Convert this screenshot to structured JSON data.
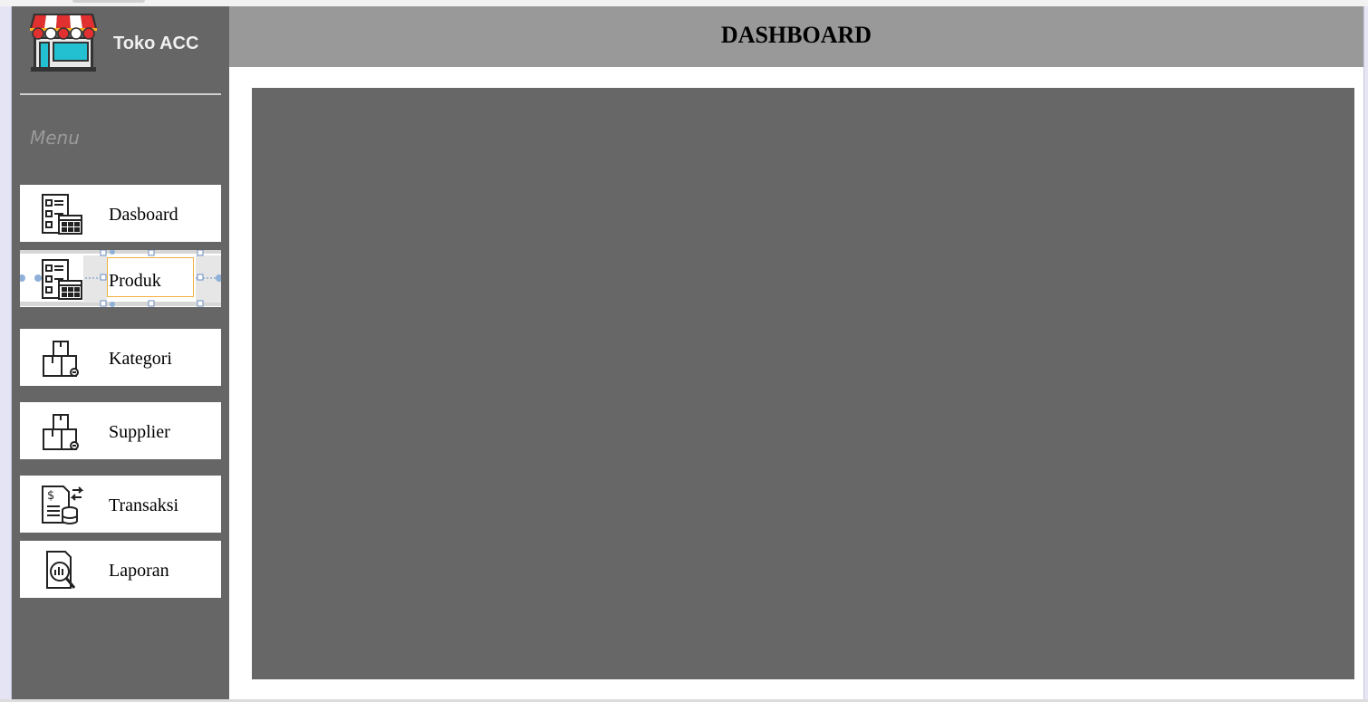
{
  "app": {
    "name": "Toko ACC"
  },
  "header": {
    "title": "DASHBOARD"
  },
  "sidebar": {
    "menu_label": "Menu",
    "items": [
      {
        "label": "Dasboard",
        "icon": "checklist-calendar-icon"
      },
      {
        "label": "Produk",
        "icon": "checklist-calendar-icon",
        "selected": true
      },
      {
        "label": "Kategori",
        "icon": "boxes-icon"
      },
      {
        "label": "Supplier",
        "icon": "boxes-icon"
      },
      {
        "label": "Transaksi",
        "icon": "invoice-database-icon"
      },
      {
        "label": "Laporan",
        "icon": "report-search-icon"
      }
    ]
  },
  "colors": {
    "sidebar_bg": "#666666",
    "header_bg": "#999999",
    "panel_bg": "#676767",
    "selection_border": "#f0b040"
  }
}
